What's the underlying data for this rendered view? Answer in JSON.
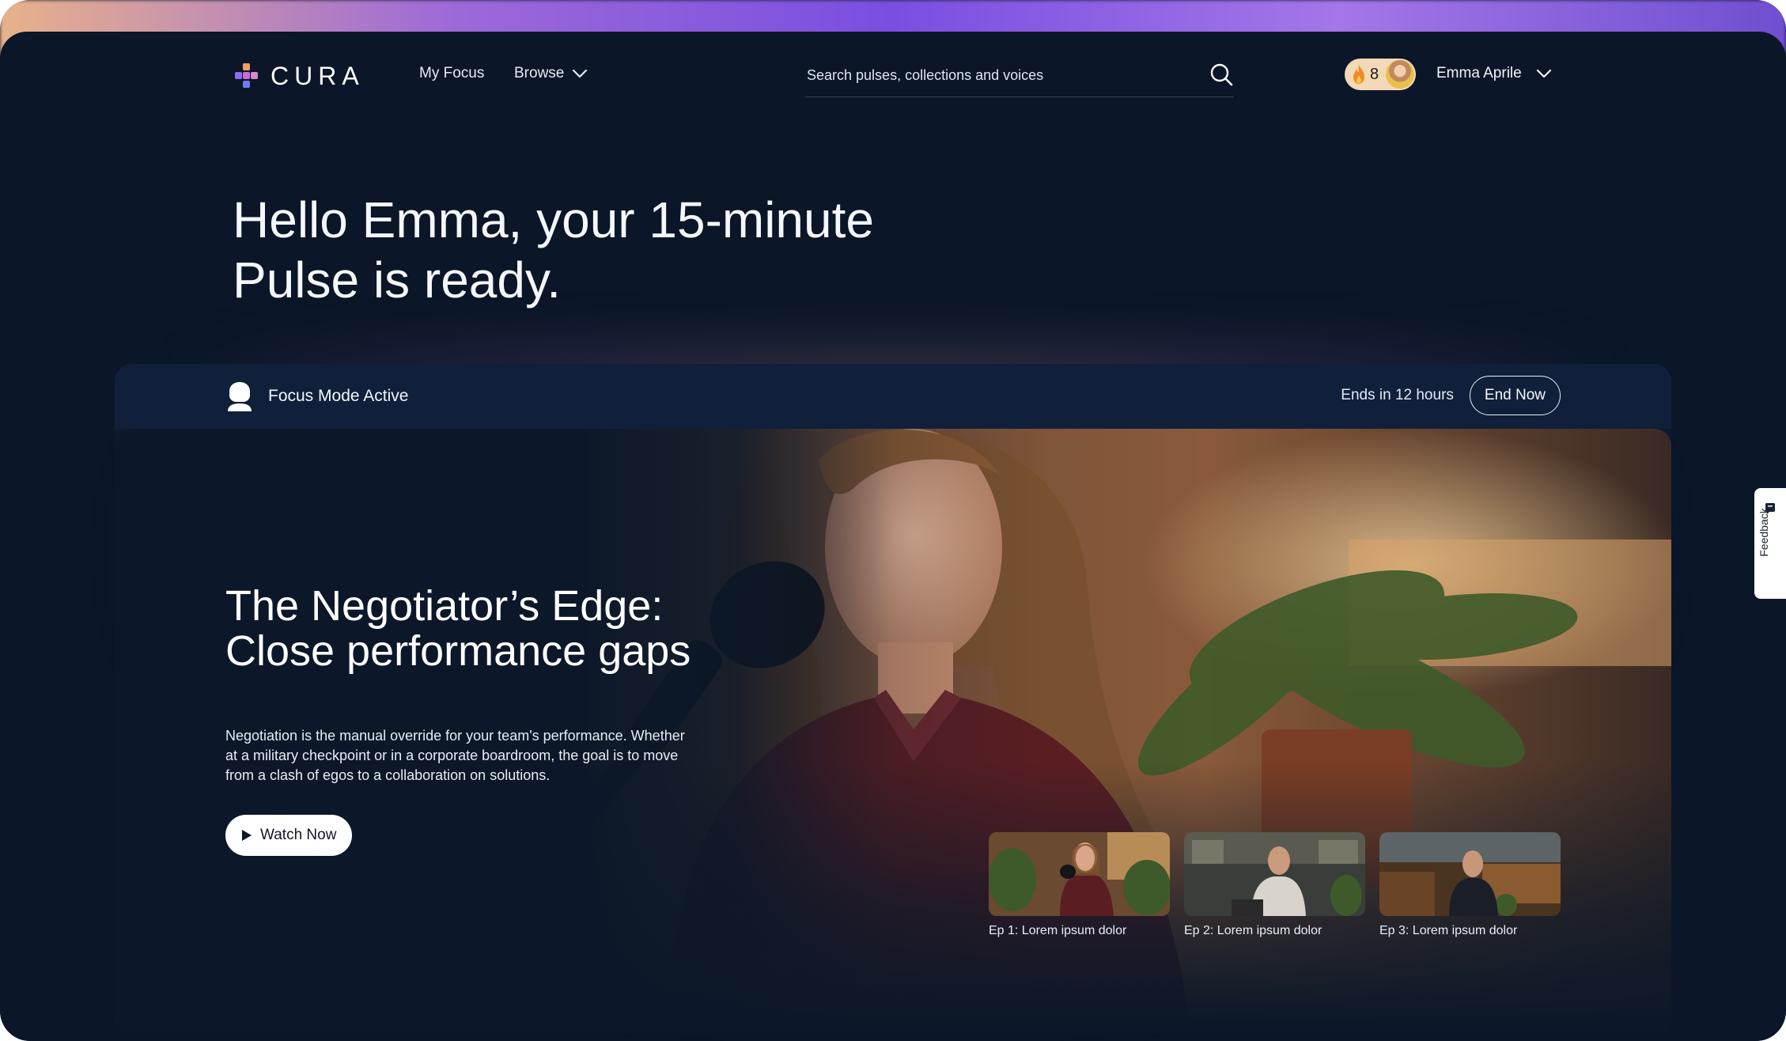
{
  "app": {
    "brand": "CURA"
  },
  "nav": {
    "my_focus": "My Focus",
    "browse": "Browse",
    "search_placeholder": "Search pulses, collections and voices",
    "streak_count": "8",
    "user_name": "Emma Aprile"
  },
  "greeting": "Hello Emma, your 15-minute Pulse is ready.",
  "focus": {
    "status": "Focus Mode Active",
    "ends_text": "Ends in 12 hours",
    "end_button": "End Now"
  },
  "hero": {
    "title": "The Negotiator’s Edge: Close performance gaps",
    "description": "Negotiation is the manual override for your team's performance. Whether at a military checkpoint or in a corporate boardroom, the goal is to move from a clash of egos to a collaboration on solutions.",
    "watch_button": "Watch Now"
  },
  "episodes": [
    {
      "label": "Ep 1: Lorem ipsum dolor"
    },
    {
      "label": "Ep 2: Lorem ipsum dolor"
    },
    {
      "label": "Ep 3: Lorem ipsum dolor"
    }
  ],
  "feedback": {
    "label": "Feedback"
  },
  "icons": {
    "logo": "cura-logo-icon",
    "browse_chevron": "chevron-down-icon",
    "search": "search-icon",
    "streak": "flame-icon",
    "user_chevron": "chevron-down-icon",
    "focus": "focus-person-icon",
    "play": "play-icon",
    "feedback": "feedback-icon"
  },
  "colors": {
    "background": "#0b1628",
    "top_glow": "#7a4fe0",
    "streak_pill": "#f3d9b8",
    "text": "#f4f7fb"
  }
}
